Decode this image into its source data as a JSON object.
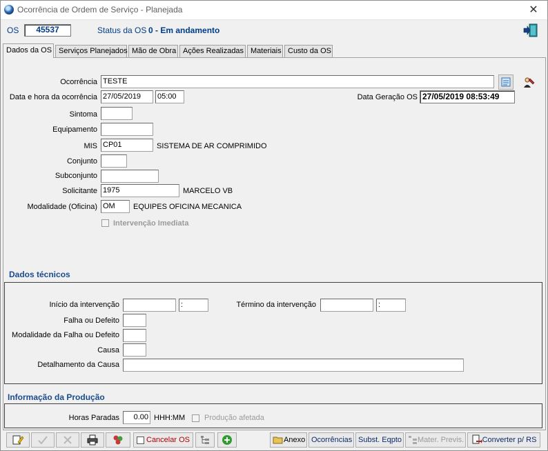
{
  "window": {
    "title": "Ocorrência de Ordem de Serviço - Planejada",
    "close_glyph": "✕"
  },
  "header": {
    "os_label": "OS",
    "os_number": "45537",
    "status_label": "Status da OS",
    "status_value": "0 - Em andamento"
  },
  "tabs": [
    {
      "label": "Dados da OS",
      "active": true
    },
    {
      "label": "Serviços Planejados"
    },
    {
      "label": "Mão de Obra"
    },
    {
      "label": "Ações Realizadas"
    },
    {
      "label": "Materiais"
    },
    {
      "label": "Custo da OS"
    }
  ],
  "form": {
    "ocorrencia_label": "Ocorrência",
    "ocorrencia_value": "TESTE",
    "data_hora_label": "Data e hora da ocorrência",
    "data_value": "27/05/2019",
    "hora_value": "05:00",
    "data_geracao_label": "Data Geração OS",
    "data_geracao_value": "27/05/2019 08:53:49",
    "sintoma_label": "Sintoma",
    "sintoma_value": "",
    "equipamento_label": "Equipamento",
    "equipamento_value": "",
    "mis_label": "MIS",
    "mis_value": "CP01",
    "mis_desc": "SISTEMA DE AR COMPRIMIDO",
    "conjunto_label": "Conjunto",
    "conjunto_value": "",
    "subconjunto_label": "Subconjunto",
    "subconjunto_value": "",
    "solicitante_label": "Solicitante",
    "solicitante_value": "1975",
    "solicitante_desc": "MARCELO VB",
    "modalidade_label": "Modalidade (Oficina)",
    "modalidade_value": "OM",
    "modalidade_desc": "EQUIPES OFICINA MECANICA",
    "intervencao_label": "Intervenção Imediata"
  },
  "dados_tecnicos": {
    "title": "Dados técnicos",
    "inicio_label": "Início da intervenção",
    "inicio_date": "",
    "inicio_time": ":",
    "termino_label": "Término da intervenção",
    "termino_date": "",
    "termino_time": ":",
    "falha_label": "Falha ou Defeito",
    "modalidade_falha_label": "Modalidade da Falha ou Defeito",
    "causa_label": "Causa",
    "detalhamento_label": "Detalhamento da Causa"
  },
  "producao": {
    "title": "Informação da Produção",
    "horas_label": "Horas Paradas",
    "horas_value": "0.00",
    "horas_unit": "HHH:MM",
    "producao_afetada_label": "Produção afetada"
  },
  "toolbar": {
    "cancelar_label": "Cancelar OS",
    "anexo_label": "Anexo",
    "ocorrencias_label": "Ocorrências",
    "subst_label": "Subst. Eqpto",
    "mater_label": "Mater. Previs.",
    "converter_label": "Converter p/ RS"
  },
  "colors": {
    "accent_blue": "#003c88",
    "section_blue": "#1a4b8c",
    "cancel_red": "#b00000"
  }
}
